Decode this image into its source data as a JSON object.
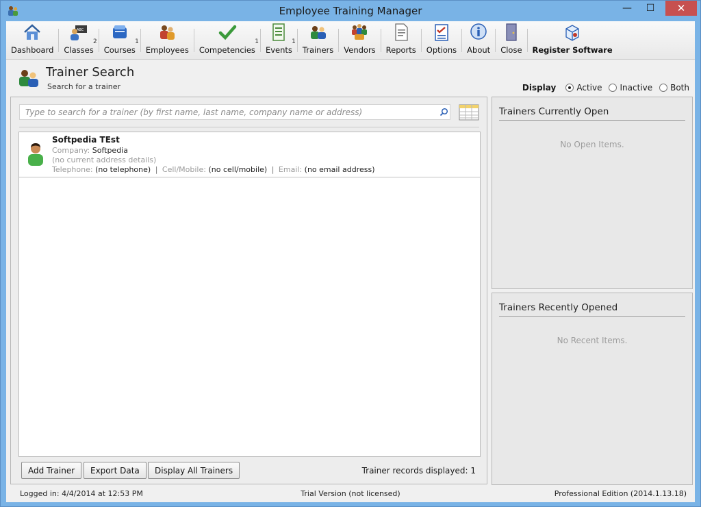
{
  "window": {
    "title": "Employee Training Manager",
    "minimize": "—",
    "maximize": "☐",
    "close": "✕"
  },
  "toolbar": {
    "items": [
      {
        "label": "Dashboard",
        "count": ""
      },
      {
        "label": "Classes",
        "count": "2"
      },
      {
        "label": "Courses",
        "count": "1"
      },
      {
        "label": "Employees",
        "count": ""
      },
      {
        "label": "Competencies",
        "count": "1"
      },
      {
        "label": "Events",
        "count": "1"
      },
      {
        "label": "Trainers",
        "count": ""
      },
      {
        "label": "Vendors",
        "count": ""
      },
      {
        "label": "Reports",
        "count": ""
      },
      {
        "label": "Options",
        "count": ""
      },
      {
        "label": "About",
        "count": ""
      },
      {
        "label": "Close",
        "count": ""
      },
      {
        "label": "Register Software",
        "count": ""
      }
    ]
  },
  "header": {
    "title": "Trainer Search",
    "subtitle": "Search for a trainer"
  },
  "display": {
    "label": "Display",
    "options": [
      "Active",
      "Inactive",
      "Both"
    ],
    "selected": "Active"
  },
  "search": {
    "placeholder": "Type to search for a trainer (by first name, last name, company name or address)"
  },
  "results": [
    {
      "name": "Softpedia TEst",
      "company_label": "Company:",
      "company": "Softpedia",
      "address": "(no current address details)",
      "telephone_label": "Telephone:",
      "telephone": "(no telephone)",
      "cell_label": "Cell/Mobile:",
      "cell": "(no cell/mobile)",
      "email_label": "Email:",
      "email": "(no email address)"
    }
  ],
  "buttons": {
    "add": "Add Trainer",
    "export": "Export Data",
    "display_all": "Display All Trainers"
  },
  "records_text": "Trainer records displayed:  1",
  "side": {
    "open_title": "Trainers Currently Open",
    "open_empty": "No Open Items.",
    "recent_title": "Trainers Recently Opened",
    "recent_empty": "No Recent Items."
  },
  "status": {
    "logged_in": "Logged in:  4/4/2014 at 12:53 PM",
    "license": "Trial Version (not licensed)",
    "edition": "Professional Edition (2014.1.13.18)"
  },
  "colors": {
    "title_bar": "#79b3e6",
    "close_button": "#c75050",
    "window_bg": "#f0f0f0"
  }
}
